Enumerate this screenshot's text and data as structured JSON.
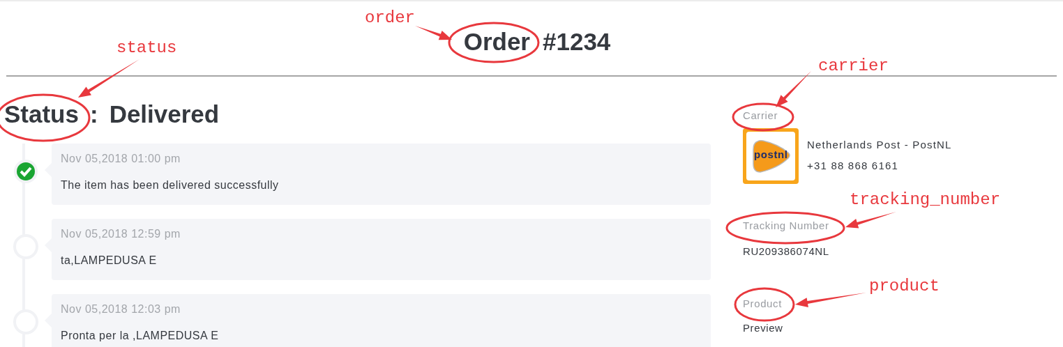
{
  "title": {
    "label": "Order",
    "number": "#1234"
  },
  "status": {
    "label": "Status",
    "separator": ":",
    "value": "Delivered"
  },
  "timeline": [
    {
      "time": "Nov 05,2018 01:00 pm",
      "text": "The item has been delivered successfully",
      "done": true
    },
    {
      "time": "Nov 05,2018 12:59 pm",
      "text": "ta,LAMPEDUSA E",
      "done": false
    },
    {
      "time": "Nov 05,2018 12:03 pm",
      "text": "Pronta per la ,LAMPEDUSA E",
      "done": false
    }
  ],
  "carrier": {
    "label": "Carrier",
    "logo_text": "postnl",
    "name": "Netherlands Post - PostNL",
    "phone": "+31 88 868 6161"
  },
  "tracking": {
    "label": "Tracking Number",
    "value": "RU209386074NL"
  },
  "product": {
    "label": "Product",
    "value": "Preview"
  },
  "annotations": [
    {
      "label": "order"
    },
    {
      "label": "status"
    },
    {
      "label": "carrier"
    },
    {
      "label": "tracking_number"
    },
    {
      "label": "product"
    }
  ]
}
